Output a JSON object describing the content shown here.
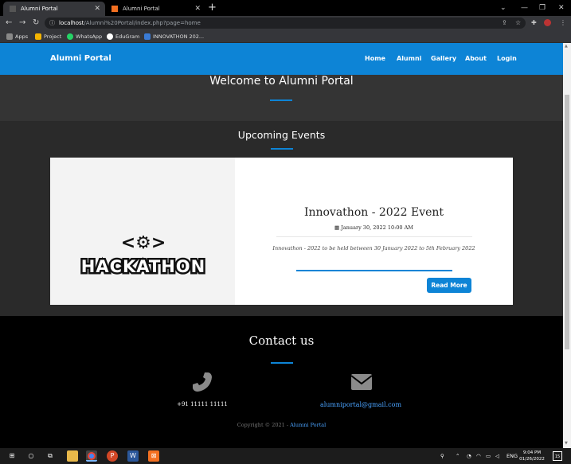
{
  "browser": {
    "tabs": [
      {
        "title": "Alumni Portal",
        "active": true
      },
      {
        "title": "Alumni Portal",
        "active": false
      }
    ],
    "url_host": "localhost",
    "url_path": "/Alumni%20Portal/index.php?page=home",
    "bookmarks": [
      "Apps",
      "Project",
      "WhatsApp",
      "EduGram",
      "INNOVATHON 202..."
    ]
  },
  "site": {
    "brand": "Alumni Portal",
    "nav": [
      "Home",
      "Alumni",
      "Gallery",
      "About",
      "Login"
    ],
    "hero_title": "Welcome to Alumni Portal",
    "events_heading": "Upcoming Events",
    "event": {
      "image_text": "HACKATHON",
      "title": "Innovathon - 2022 Event",
      "date": "January 30, 2022 10:00 AM",
      "description": "Innovathon - 2022 to be held between 30 January 2022 to 5th February 2022",
      "button": "Read More"
    },
    "contact": {
      "heading": "Contact us",
      "phone": "+91 11111 11111",
      "email": "alumniportal@gmail.com",
      "copyright_prefix": "Copyright © 2021 - ",
      "copyright_link": "Alumni Portal"
    }
  },
  "taskbar": {
    "lang": "ENG",
    "time": "9:04 PM",
    "date": "01/26/2022",
    "notifications": "15"
  },
  "colors": {
    "accent": "#0d84d6",
    "link": "#4aa3ff"
  }
}
